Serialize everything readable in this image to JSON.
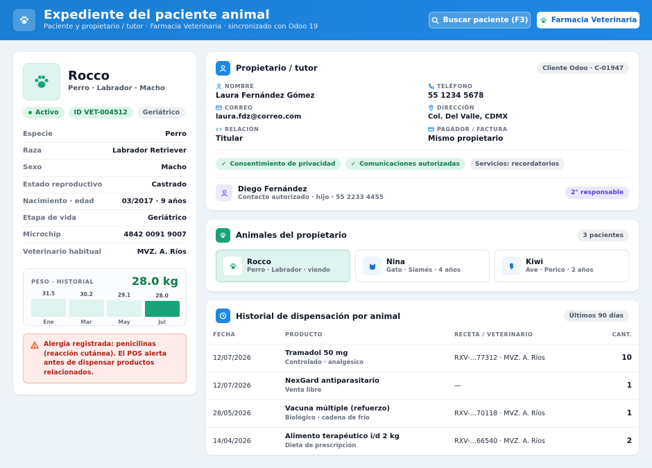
{
  "header": {
    "title": "Expediente del paciente animal",
    "subtitle": "Paciente y propietario / tutor · Farmacia Veterinaria · sincronizado con Odoo 19",
    "search_button": "Buscar paciente (F3)",
    "pharmacy_button": "Farmacia Veterinaria"
  },
  "patient": {
    "name": "Rocco",
    "breed_line": "Perro · Labrador · Macho",
    "badges": {
      "status": "Activo",
      "id": "ID VET-004512",
      "stage": "Geriátrico"
    },
    "details": [
      {
        "label": "Especie",
        "value": "Perro"
      },
      {
        "label": "Raza",
        "value": "Labrador Retriever"
      },
      {
        "label": "Sexo",
        "value": "Macho"
      },
      {
        "label": "Estado reproductivo",
        "value": "Castrado"
      },
      {
        "label": "Nacimiento · edad",
        "value": "03/2017 · 9 años"
      },
      {
        "label": "Etapa de vida",
        "value": "Geriátrico"
      },
      {
        "label": "Microchip",
        "value": "4842 0091 9007"
      },
      {
        "label": "Veterinario habitual",
        "value": "MVZ. A. Ríos"
      }
    ],
    "weight": {
      "label": "PESO · HISTORIAL",
      "current": "28.0 kg",
      "history": [
        {
          "month": "Ene",
          "value": "31.5"
        },
        {
          "month": "Mar",
          "value": "30.2"
        },
        {
          "month": "May",
          "value": "29.1"
        },
        {
          "month": "Jul",
          "value": "28.0"
        }
      ]
    },
    "alert": "Alergia registrada: penicilinas (reacción cutánea). El POS alerta antes de dispensar productos relacionados."
  },
  "owner": {
    "title": "Propietario / tutor",
    "client_badge": "Cliente Odoo · C-01947",
    "name_label": "NOMBRE",
    "name": "Laura Fernández Gómez",
    "phone_label": "TELÉFONO",
    "phone": "55 1234 5678",
    "email_label": "CORREO",
    "email": "laura.fdz@correo.com",
    "address_label": "DIRECCIÓN",
    "address": "Col. Del Valle, CDMX",
    "relation_label": "RELACIÓN",
    "relation": "Titular",
    "payer_label": "PAGADOR / FACTURA",
    "payer": "Mismo propietario",
    "chips": {
      "privacy": "Consentimiento de privacidad",
      "comms": "Comunicaciones autorizadas",
      "services": "Servicios: recordatorios"
    },
    "contact": {
      "name": "Diego Fernández",
      "detail": "Contacto autorizado · hijo · 55 2233 4455",
      "role": "2° responsable"
    }
  },
  "animals": {
    "title": "Animales del propietario",
    "count": "3 pacientes",
    "items": [
      {
        "name": "Rocco",
        "detail": "Perro · Labrador · viendo",
        "icon": "paw-icon"
      },
      {
        "name": "Nina",
        "detail": "Gato · Siamés · 4 años",
        "icon": "cat-icon"
      },
      {
        "name": "Kiwi",
        "detail": "Ave · Perico · 2 años",
        "icon": "bird-icon"
      }
    ]
  },
  "history": {
    "title": "Historial de dispensación por animal",
    "range": "Últimos 90 días",
    "columns": {
      "date": "FECHA",
      "product": "PRODUCTO",
      "rx": "RECETA / VETERINARIO",
      "qty": "CANT."
    },
    "rows": [
      {
        "date": "12/07/2026",
        "product": "Tramadol 50 mg",
        "sub": "Controlado · analgésico",
        "rx": "RXV-…77312 · MVZ. A. Ríos",
        "qty": "10"
      },
      {
        "date": "12/07/2026",
        "product": "NexGard antiparasitario",
        "sub": "Venta libre",
        "rx": "—",
        "qty": "1"
      },
      {
        "date": "28/05/2026",
        "product": "Vacuna múltiple (refuerzo)",
        "sub": "Biológico · cadena de frío",
        "rx": "RXV-…70118 · MVZ. A. Ríos",
        "qty": "1"
      },
      {
        "date": "14/04/2026",
        "product": "Alimento terapéutico i/d 2 kg",
        "sub": "Dieta de prescripción",
        "rx": "RXV-…66540 · MVZ. A. Ríos",
        "qty": "2"
      }
    ]
  },
  "colors": {
    "brand": "#1e88e5",
    "success": "#117a4a",
    "danger": "#b42318",
    "accent_purple": "#5b43c8"
  }
}
